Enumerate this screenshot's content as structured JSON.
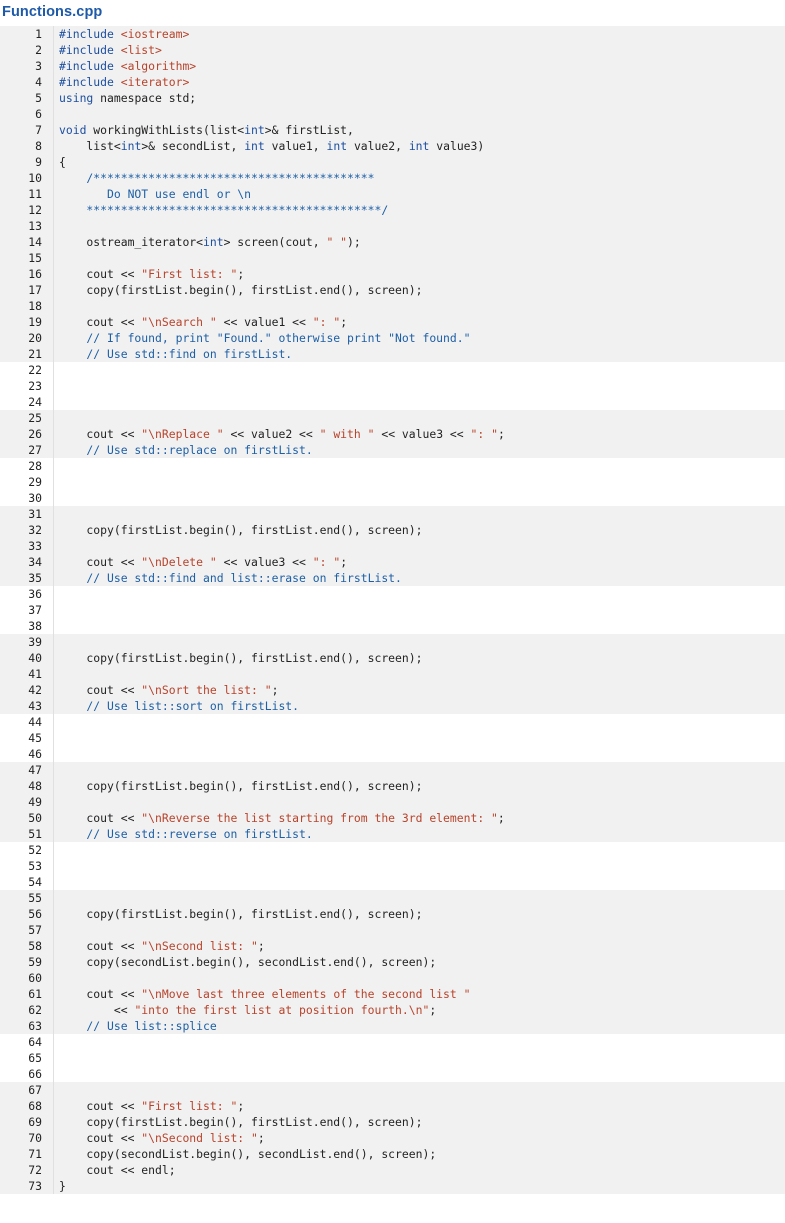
{
  "file": {
    "title": "Functions.cpp"
  },
  "colors": {
    "keyword": "#1d4fa0",
    "string": "#b8432b",
    "comment": "#1d5fa6",
    "title": "#1e5aa8",
    "line_bg": "#f1f1f1",
    "blank_bg": "#ffffff"
  },
  "lines": [
    {
      "n": "1",
      "blank": false,
      "t": [
        {
          "k": "kw",
          "v": "#include "
        },
        {
          "k": "str",
          "v": "<iostream>"
        }
      ]
    },
    {
      "n": "2",
      "blank": false,
      "t": [
        {
          "k": "kw",
          "v": "#include "
        },
        {
          "k": "str",
          "v": "<list>"
        }
      ]
    },
    {
      "n": "3",
      "blank": false,
      "t": [
        {
          "k": "kw",
          "v": "#include "
        },
        {
          "k": "str",
          "v": "<algorithm>"
        }
      ]
    },
    {
      "n": "4",
      "blank": false,
      "t": [
        {
          "k": "kw",
          "v": "#include "
        },
        {
          "k": "str",
          "v": "<iterator>"
        }
      ]
    },
    {
      "n": "5",
      "blank": false,
      "t": [
        {
          "k": "kw",
          "v": "using "
        },
        {
          "k": "p",
          "v": "namespace std;"
        }
      ]
    },
    {
      "n": "6",
      "blank": false,
      "t": []
    },
    {
      "n": "7",
      "blank": false,
      "t": [
        {
          "k": "kw",
          "v": "void "
        },
        {
          "k": "p",
          "v": "workingWithLists(list<"
        },
        {
          "k": "kw",
          "v": "int"
        },
        {
          "k": "p",
          "v": ">& firstList,"
        }
      ]
    },
    {
      "n": "8",
      "blank": false,
      "t": [
        {
          "k": "p",
          "v": "    list<"
        },
        {
          "k": "kw",
          "v": "int"
        },
        {
          "k": "p",
          "v": ">& secondList, "
        },
        {
          "k": "kw",
          "v": "int "
        },
        {
          "k": "p",
          "v": "value1, "
        },
        {
          "k": "kw",
          "v": "int "
        },
        {
          "k": "p",
          "v": "value2, "
        },
        {
          "k": "kw",
          "v": "int "
        },
        {
          "k": "p",
          "v": "value3)"
        }
      ]
    },
    {
      "n": "9",
      "blank": false,
      "t": [
        {
          "k": "p",
          "v": "{"
        }
      ]
    },
    {
      "n": "10",
      "blank": false,
      "t": [
        {
          "k": "com",
          "v": "    /*****************************************"
        }
      ]
    },
    {
      "n": "11",
      "blank": false,
      "t": [
        {
          "k": "com",
          "v": "       Do NOT use endl or \\n"
        }
      ]
    },
    {
      "n": "12",
      "blank": false,
      "t": [
        {
          "k": "com",
          "v": "    *******************************************/"
        }
      ]
    },
    {
      "n": "13",
      "blank": false,
      "t": []
    },
    {
      "n": "14",
      "blank": false,
      "t": [
        {
          "k": "p",
          "v": "    ostream_iterator<"
        },
        {
          "k": "kw",
          "v": "int"
        },
        {
          "k": "p",
          "v": "> screen(cout, "
        },
        {
          "k": "str",
          "v": "\" \""
        },
        {
          "k": "p",
          "v": ");"
        }
      ]
    },
    {
      "n": "15",
      "blank": false,
      "t": []
    },
    {
      "n": "16",
      "blank": false,
      "t": [
        {
          "k": "p",
          "v": "    cout << "
        },
        {
          "k": "str",
          "v": "\"First list: \""
        },
        {
          "k": "p",
          "v": ";"
        }
      ]
    },
    {
      "n": "17",
      "blank": false,
      "t": [
        {
          "k": "p",
          "v": "    copy(firstList.begin(), firstList.end(), screen);"
        }
      ]
    },
    {
      "n": "18",
      "blank": false,
      "t": []
    },
    {
      "n": "19",
      "blank": false,
      "t": [
        {
          "k": "p",
          "v": "    cout << "
        },
        {
          "k": "str",
          "v": "\"\\nSearch \""
        },
        {
          "k": "p",
          "v": " << value1 << "
        },
        {
          "k": "str",
          "v": "\": \""
        },
        {
          "k": "p",
          "v": ";"
        }
      ]
    },
    {
      "n": "20",
      "blank": false,
      "t": [
        {
          "k": "com",
          "v": "    // If found, print \"Found.\" otherwise print \"Not found.\""
        }
      ]
    },
    {
      "n": "21",
      "blank": false,
      "t": [
        {
          "k": "com",
          "v": "    // Use std::find on firstList."
        }
      ]
    },
    {
      "n": "22",
      "blank": true,
      "t": []
    },
    {
      "n": "23",
      "blank": true,
      "t": []
    },
    {
      "n": "24",
      "blank": true,
      "t": []
    },
    {
      "n": "25",
      "blank": false,
      "t": []
    },
    {
      "n": "26",
      "blank": false,
      "t": [
        {
          "k": "p",
          "v": "    cout << "
        },
        {
          "k": "str",
          "v": "\"\\nReplace \""
        },
        {
          "k": "p",
          "v": " << value2 << "
        },
        {
          "k": "str",
          "v": "\" with \""
        },
        {
          "k": "p",
          "v": " << value3 << "
        },
        {
          "k": "str",
          "v": "\": \""
        },
        {
          "k": "p",
          "v": ";"
        }
      ]
    },
    {
      "n": "27",
      "blank": false,
      "t": [
        {
          "k": "com",
          "v": "    // Use std::replace on firstList."
        }
      ]
    },
    {
      "n": "28",
      "blank": true,
      "t": []
    },
    {
      "n": "29",
      "blank": true,
      "t": []
    },
    {
      "n": "30",
      "blank": true,
      "t": []
    },
    {
      "n": "31",
      "blank": false,
      "t": []
    },
    {
      "n": "32",
      "blank": false,
      "t": [
        {
          "k": "p",
          "v": "    copy(firstList.begin(), firstList.end(), screen);"
        }
      ]
    },
    {
      "n": "33",
      "blank": false,
      "t": []
    },
    {
      "n": "34",
      "blank": false,
      "t": [
        {
          "k": "p",
          "v": "    cout << "
        },
        {
          "k": "str",
          "v": "\"\\nDelete \""
        },
        {
          "k": "p",
          "v": " << value3 << "
        },
        {
          "k": "str",
          "v": "\": \""
        },
        {
          "k": "p",
          "v": ";"
        }
      ]
    },
    {
      "n": "35",
      "blank": false,
      "t": [
        {
          "k": "com",
          "v": "    // Use std::find and list::erase on firstList."
        }
      ]
    },
    {
      "n": "36",
      "blank": true,
      "t": []
    },
    {
      "n": "37",
      "blank": true,
      "t": []
    },
    {
      "n": "38",
      "blank": true,
      "t": []
    },
    {
      "n": "39",
      "blank": false,
      "t": []
    },
    {
      "n": "40",
      "blank": false,
      "t": [
        {
          "k": "p",
          "v": "    copy(firstList.begin(), firstList.end(), screen);"
        }
      ]
    },
    {
      "n": "41",
      "blank": false,
      "t": []
    },
    {
      "n": "42",
      "blank": false,
      "t": [
        {
          "k": "p",
          "v": "    cout << "
        },
        {
          "k": "str",
          "v": "\"\\nSort the list: \""
        },
        {
          "k": "p",
          "v": ";"
        }
      ]
    },
    {
      "n": "43",
      "blank": false,
      "t": [
        {
          "k": "com",
          "v": "    // Use list::sort on firstList."
        }
      ]
    },
    {
      "n": "44",
      "blank": true,
      "t": []
    },
    {
      "n": "45",
      "blank": true,
      "t": []
    },
    {
      "n": "46",
      "blank": true,
      "t": []
    },
    {
      "n": "47",
      "blank": false,
      "t": []
    },
    {
      "n": "48",
      "blank": false,
      "t": [
        {
          "k": "p",
          "v": "    copy(firstList.begin(), firstList.end(), screen);"
        }
      ]
    },
    {
      "n": "49",
      "blank": false,
      "t": []
    },
    {
      "n": "50",
      "blank": false,
      "t": [
        {
          "k": "p",
          "v": "    cout << "
        },
        {
          "k": "str",
          "v": "\"\\nReverse the list starting from the 3rd element: \""
        },
        {
          "k": "p",
          "v": ";"
        }
      ]
    },
    {
      "n": "51",
      "blank": false,
      "t": [
        {
          "k": "com",
          "v": "    // Use std::reverse on firstList."
        }
      ]
    },
    {
      "n": "52",
      "blank": true,
      "t": []
    },
    {
      "n": "53",
      "blank": true,
      "t": []
    },
    {
      "n": "54",
      "blank": true,
      "t": []
    },
    {
      "n": "55",
      "blank": false,
      "t": []
    },
    {
      "n": "56",
      "blank": false,
      "t": [
        {
          "k": "p",
          "v": "    copy(firstList.begin(), firstList.end(), screen);"
        }
      ]
    },
    {
      "n": "57",
      "blank": false,
      "t": []
    },
    {
      "n": "58",
      "blank": false,
      "t": [
        {
          "k": "p",
          "v": "    cout << "
        },
        {
          "k": "str",
          "v": "\"\\nSecond list: \""
        },
        {
          "k": "p",
          "v": ";"
        }
      ]
    },
    {
      "n": "59",
      "blank": false,
      "t": [
        {
          "k": "p",
          "v": "    copy(secondList.begin(), secondList.end(), screen);"
        }
      ]
    },
    {
      "n": "60",
      "blank": false,
      "t": []
    },
    {
      "n": "61",
      "blank": false,
      "t": [
        {
          "k": "p",
          "v": "    cout << "
        },
        {
          "k": "str",
          "v": "\"\\nMove last three elements of the second list \""
        }
      ]
    },
    {
      "n": "62",
      "blank": false,
      "t": [
        {
          "k": "p",
          "v": "        << "
        },
        {
          "k": "str",
          "v": "\"into the first list at position fourth.\\n\""
        },
        {
          "k": "p",
          "v": ";"
        }
      ]
    },
    {
      "n": "63",
      "blank": false,
      "t": [
        {
          "k": "com",
          "v": "    // Use list::splice"
        }
      ]
    },
    {
      "n": "64",
      "blank": true,
      "t": []
    },
    {
      "n": "65",
      "blank": true,
      "t": []
    },
    {
      "n": "66",
      "blank": true,
      "t": []
    },
    {
      "n": "67",
      "blank": false,
      "t": []
    },
    {
      "n": "68",
      "blank": false,
      "t": [
        {
          "k": "p",
          "v": "    cout << "
        },
        {
          "k": "str",
          "v": "\"First list: \""
        },
        {
          "k": "p",
          "v": ";"
        }
      ]
    },
    {
      "n": "69",
      "blank": false,
      "t": [
        {
          "k": "p",
          "v": "    copy(firstList.begin(), firstList.end(), screen);"
        }
      ]
    },
    {
      "n": "70",
      "blank": false,
      "t": [
        {
          "k": "p",
          "v": "    cout << "
        },
        {
          "k": "str",
          "v": "\"\\nSecond list: \""
        },
        {
          "k": "p",
          "v": ";"
        }
      ]
    },
    {
      "n": "71",
      "blank": false,
      "t": [
        {
          "k": "p",
          "v": "    copy(secondList.begin(), secondList.end(), screen);"
        }
      ]
    },
    {
      "n": "72",
      "blank": false,
      "t": [
        {
          "k": "p",
          "v": "    cout << endl;"
        }
      ]
    },
    {
      "n": "73",
      "blank": false,
      "t": [
        {
          "k": "p",
          "v": "}"
        }
      ]
    }
  ]
}
